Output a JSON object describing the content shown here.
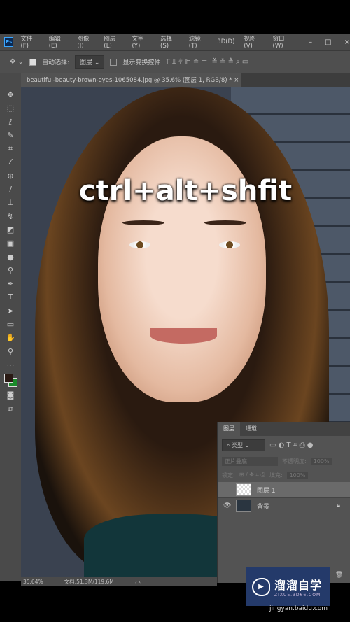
{
  "app": {
    "logo": "Ps"
  },
  "menu": [
    "文件(F)",
    "编辑(E)",
    "图像(I)",
    "图层(L)",
    "文字(Y)",
    "选择(S)",
    "滤镜(T)",
    "3D(D)",
    "视图(V)",
    "窗口(W)"
  ],
  "window_controls": {
    "minimize": "–",
    "maximize": "□",
    "close": "×"
  },
  "options": {
    "auto_select_label": "自动选择:",
    "auto_select_checked": true,
    "target_value": "图层",
    "show_transform_label": "显示变换控件",
    "show_transform_checked": false
  },
  "document_tab": {
    "title": "beautiful-beauty-brown-eyes-1065084.jpg @ 35.6% (图层 1, RGB/8) *",
    "close": "×"
  },
  "overlay_text": "ctrl+alt+shfit",
  "status": {
    "zoom": "35.64%",
    "doc": "文档:51.3M/119.6M"
  },
  "layers_panel": {
    "tabs": [
      "图层",
      "通道"
    ],
    "filter": "类型",
    "blend_mode": "正片叠底",
    "opacity_label": "不透明度:",
    "opacity": "100%",
    "lock_label": "锁定:",
    "fill_label": "填充:",
    "fill": "100%",
    "layers": [
      {
        "name": "图层 1",
        "visible": false,
        "selected": true
      },
      {
        "name": "背景",
        "visible": true,
        "locked": true
      }
    ]
  },
  "colors": {
    "foreground": "#2a1a14",
    "background": "#1a8a2a"
  },
  "watermark": {
    "title": "溜溜自学",
    "url": "ZIXUE.3D66.COM"
  },
  "source": "jingyan.baidu.com"
}
